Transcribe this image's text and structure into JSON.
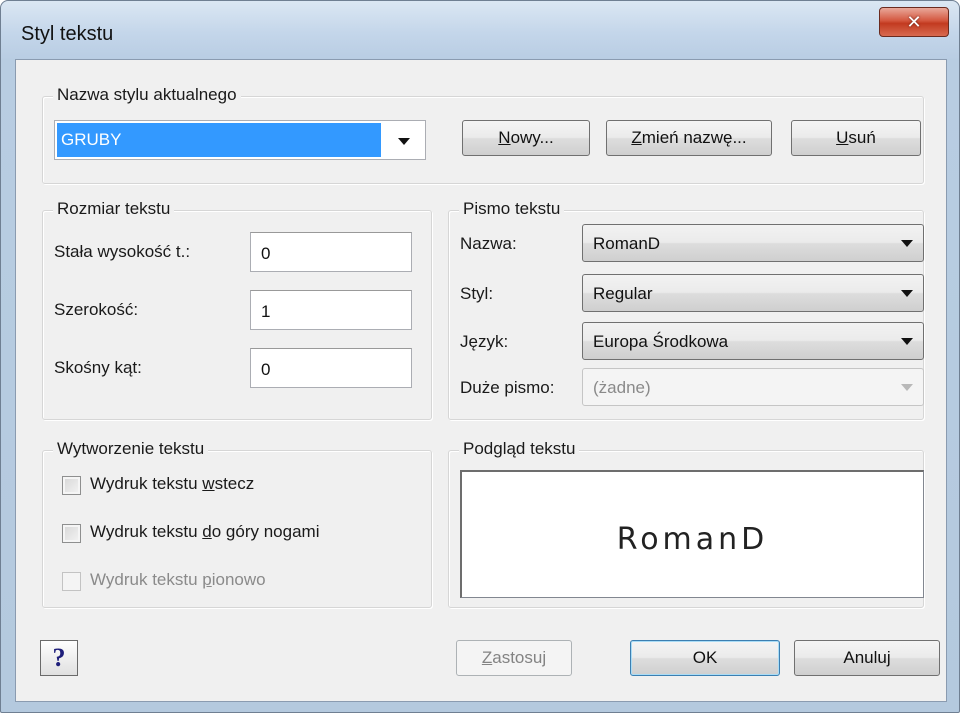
{
  "window": {
    "title": "Styl tekstu",
    "close_glyph": "✕"
  },
  "current_style": {
    "legend": "Nazwa stylu aktualnego",
    "value": "GRUBY",
    "buttons": [
      {
        "underline": "N",
        "rest": "owy..."
      },
      {
        "underline": "Z",
        "rest": "mień nazwę..."
      },
      {
        "underline": "U",
        "rest": "suń"
      }
    ]
  },
  "text_size": {
    "legend": "Rozmiar tekstu",
    "fields": [
      {
        "label": "Stała wysokość t.:",
        "value": "0"
      },
      {
        "label": "Szerokość:",
        "value": "1"
      },
      {
        "label": "Skośny kąt:",
        "value": "0"
      }
    ]
  },
  "font": {
    "legend": "Pismo tekstu",
    "fields": [
      {
        "label": "Nazwa:",
        "value": "RomanD",
        "enabled": true
      },
      {
        "label": "Styl:",
        "value": "Regular",
        "enabled": true
      },
      {
        "label": "Język:",
        "value": "Europa Środkowa",
        "enabled": true
      },
      {
        "label": "Duże pismo:",
        "value": "(żadne)",
        "enabled": false
      }
    ]
  },
  "text_generation": {
    "legend": "Wytworzenie tekstu",
    "options": [
      {
        "before": "Wydruk tekstu ",
        "underline": "w",
        "after": "stecz",
        "checked": false,
        "enabled": true
      },
      {
        "before": "Wydruk tekstu ",
        "underline": "d",
        "after": "o góry nogami",
        "checked": false,
        "enabled": true
      },
      {
        "before": "Wydruk tekstu ",
        "underline": "p",
        "after": "ionowo",
        "checked": false,
        "enabled": false
      }
    ]
  },
  "preview": {
    "legend": "Podgląd tekstu",
    "sample": "RomanD"
  },
  "footer": {
    "help_glyph": "?",
    "apply": {
      "underline": "Z",
      "rest": "astosuj",
      "enabled": false
    },
    "ok": "OK",
    "cancel": "Anuluj"
  }
}
